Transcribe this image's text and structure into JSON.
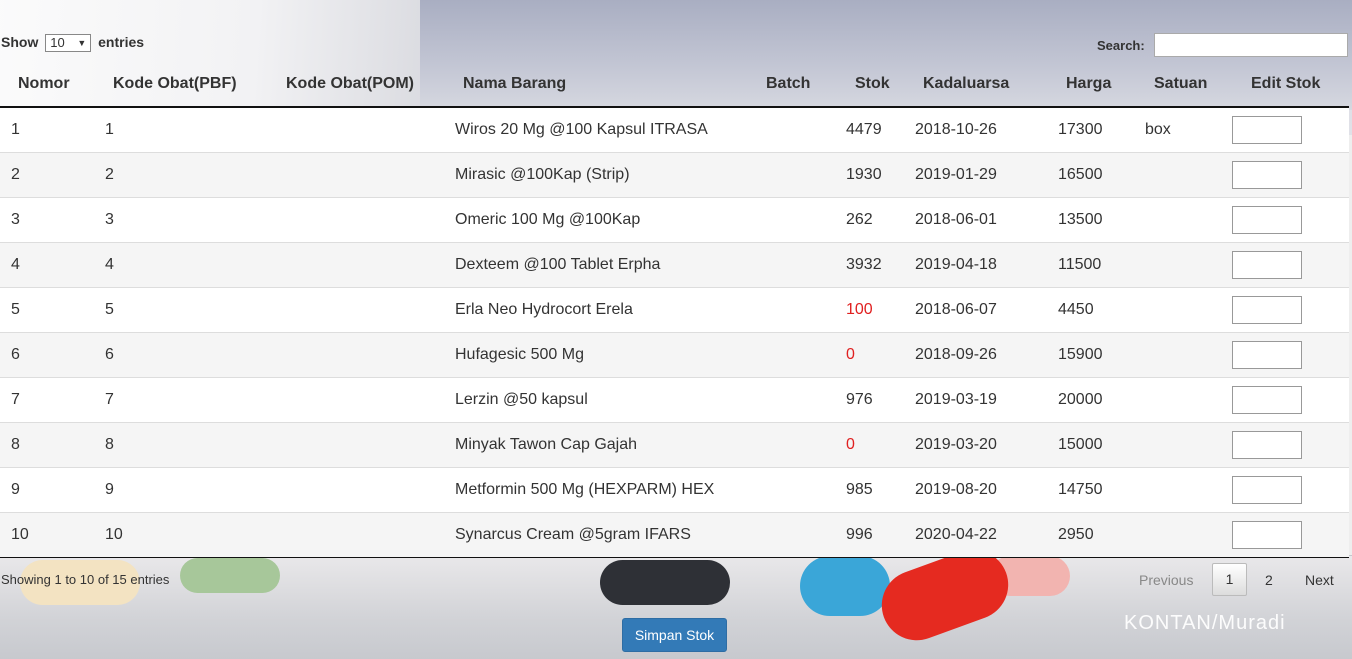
{
  "length_menu": {
    "prefix": "Show",
    "value": "10",
    "suffix": "entries"
  },
  "search": {
    "label": "Search:",
    "value": ""
  },
  "table": {
    "headers": [
      "Nomor",
      "Kode Obat(PBF)",
      "Kode Obat(POM)",
      "Nama Barang",
      "Batch",
      "Stok",
      "Kadaluarsa",
      "Harga",
      "Satuan",
      "Edit Stok"
    ],
    "rows": [
      {
        "nomor": "1",
        "kode_pbf": "1",
        "kode_pom": "",
        "nama": "Wiros 20 Mg @100 Kapsul ITRASA",
        "batch": "",
        "stok": "4479",
        "kadaluarsa": "2018-10-26",
        "harga": "17300",
        "satuan": "box",
        "low_stock": false
      },
      {
        "nomor": "2",
        "kode_pbf": "2",
        "kode_pom": "",
        "nama": "Mirasic @100Kap (Strip)",
        "batch": "",
        "stok": "1930",
        "kadaluarsa": "2019-01-29",
        "harga": "16500",
        "satuan": "",
        "low_stock": false
      },
      {
        "nomor": "3",
        "kode_pbf": "3",
        "kode_pom": "",
        "nama": "Omeric 100 Mg @100Kap",
        "batch": "",
        "stok": "262",
        "kadaluarsa": "2018-06-01",
        "harga": "13500",
        "satuan": "",
        "low_stock": false
      },
      {
        "nomor": "4",
        "kode_pbf": "4",
        "kode_pom": "",
        "nama": "Dexteem @100 Tablet Erpha",
        "batch": "",
        "stok": "3932",
        "kadaluarsa": "2019-04-18",
        "harga": "11500",
        "satuan": "",
        "low_stock": false
      },
      {
        "nomor": "5",
        "kode_pbf": "5",
        "kode_pom": "",
        "nama": "Erla Neo Hydrocort Erela",
        "batch": "",
        "stok": "100",
        "kadaluarsa": "2018-06-07",
        "harga": "4450",
        "satuan": "",
        "low_stock": true
      },
      {
        "nomor": "6",
        "kode_pbf": "6",
        "kode_pom": "",
        "nama": "Hufagesic 500 Mg",
        "batch": "",
        "stok": "0",
        "kadaluarsa": "2018-09-26",
        "harga": "15900",
        "satuan": "",
        "low_stock": true
      },
      {
        "nomor": "7",
        "kode_pbf": "7",
        "kode_pom": "",
        "nama": "Lerzin @50 kapsul",
        "batch": "",
        "stok": "976",
        "kadaluarsa": "2019-03-19",
        "harga": "20000",
        "satuan": "",
        "low_stock": false
      },
      {
        "nomor": "8",
        "kode_pbf": "8",
        "kode_pom": "",
        "nama": "Minyak Tawon Cap Gajah",
        "batch": "",
        "stok": "0",
        "kadaluarsa": "2019-03-20",
        "harga": "15000",
        "satuan": "",
        "low_stock": true
      },
      {
        "nomor": "9",
        "kode_pbf": "9",
        "kode_pom": "",
        "nama": "Metformin 500 Mg (HEXPARM) HEX",
        "batch": "",
        "stok": "985",
        "kadaluarsa": "2019-08-20",
        "harga": "14750",
        "satuan": "",
        "low_stock": false
      },
      {
        "nomor": "10",
        "kode_pbf": "10",
        "kode_pom": "",
        "nama": "Synarcus Cream @5gram IFARS",
        "batch": "",
        "stok": "996",
        "kadaluarsa": "2020-04-22",
        "harga": "2950",
        "satuan": "",
        "low_stock": false
      }
    ]
  },
  "info": "Showing 1 to 10 of 15 entries",
  "pagination": {
    "previous": "Previous",
    "pages": [
      "1",
      "2"
    ],
    "current": "1",
    "next": "Next"
  },
  "save_button": "Simpan Stok",
  "watermark": "KONTAN/Muradi",
  "colors": {
    "low_stock": "#e02020",
    "button": "#337ab7"
  }
}
